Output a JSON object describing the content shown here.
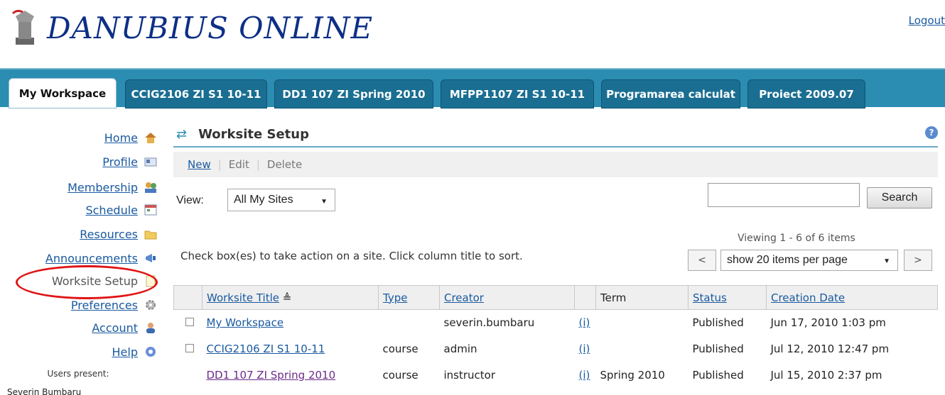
{
  "header": {
    "logo_text": "DANUBIUS ONLINE",
    "logout": "Logout"
  },
  "tabs": [
    {
      "label": "My Workspace",
      "active": true
    },
    {
      "label": "CCIG2106 ZI S1 10-11"
    },
    {
      "label": "DD1 107 ZI Spring 2010"
    },
    {
      "label": "MFPP1107 ZI S1 10-11"
    },
    {
      "label": "Programarea calculat"
    },
    {
      "label": "Proiect 2009.07"
    }
  ],
  "sidebar": {
    "items": [
      {
        "label": "Home",
        "icon": "home-icon"
      },
      {
        "label": "Profile",
        "icon": "profile-card-icon"
      },
      {
        "label": "Membership",
        "icon": "membership-icon"
      },
      {
        "label": "Schedule",
        "icon": "calendar-icon"
      },
      {
        "label": "Resources",
        "icon": "folder-icon"
      },
      {
        "label": "Announcements",
        "icon": "megaphone-icon"
      },
      {
        "label": "Worksite Setup",
        "icon": "page-icon",
        "current": true
      },
      {
        "label": "Preferences",
        "icon": "gear-icon"
      },
      {
        "label": "Account",
        "icon": "user-icon"
      },
      {
        "label": "Help",
        "icon": "help-icon"
      }
    ],
    "users_present": "Users present:",
    "user_name": "Severin Bumbaru"
  },
  "main": {
    "title": "Worksite Setup",
    "help_glyph": "?",
    "actions": {
      "new": "New",
      "edit": "Edit",
      "delete": "Delete"
    },
    "view_label": "View:",
    "view_select": "All My Sites",
    "search_button": "Search",
    "search_value": "",
    "viewing": "Viewing 1 - 6 of 6 items",
    "hint": "Check box(es) to take action on a site. Click column title to sort.",
    "pager": {
      "prev": "<",
      "next": ">",
      "per_page": "show 20 items per page"
    },
    "table": {
      "headers": {
        "title": "Worksite Title",
        "type": "Type",
        "creator": "Creator",
        "term": "Term",
        "status": "Status",
        "created": "Creation Date"
      },
      "sort_glyph": "≜",
      "rows": [
        {
          "title": "My Workspace",
          "type": "",
          "creator": "severin.bumbaru",
          "info": "(i)",
          "term": "",
          "status": "Published",
          "created": "Jun 17, 2010 1:03 pm",
          "checkbox": true
        },
        {
          "title": "CCIG2106 ZI S1 10-11",
          "type": "course",
          "creator": "admin",
          "info": "(i)",
          "term": "",
          "status": "Published",
          "created": "Jul 12, 2010 12:47 pm",
          "checkbox": true
        },
        {
          "title": "DD1 107 ZI Spring 2010",
          "type": "course",
          "creator": "instructor",
          "info": "(i)",
          "term": "Spring 2010",
          "status": "Published",
          "created": "Jul 15, 2010 2:37 pm",
          "checkbox": false,
          "visited": true
        }
      ]
    }
  }
}
